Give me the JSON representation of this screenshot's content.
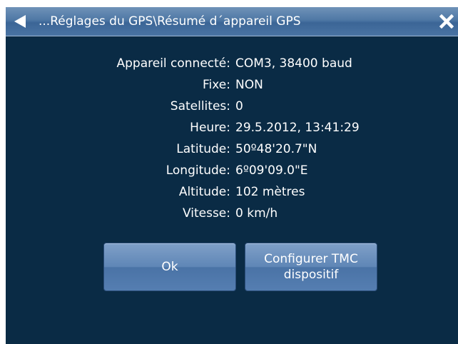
{
  "header": {
    "title": "...Réglages du GPS\\Résumé d´appareil GPS",
    "back_icon": "back-arrow-icon",
    "close_icon": "close-icon"
  },
  "summary": [
    {
      "label": "Appareil connecté:",
      "value": "COM3, 38400 baud"
    },
    {
      "label": "Fixe:",
      "value": "NON"
    },
    {
      "label": "Satellites:",
      "value": "0"
    },
    {
      "label": "Heure:",
      "value": "29.5.2012, 13:41:29"
    },
    {
      "label": "Latitude:",
      "value": "50º48'20.7\"N"
    },
    {
      "label": "Longitude:",
      "value": "6º09'09.0\"E"
    },
    {
      "label": "Altitude:",
      "value": "102 mètres"
    },
    {
      "label": "Vitesse:",
      "value": "0 km/h"
    }
  ],
  "buttons": {
    "ok_label": "Ok",
    "tmc_label_line1": "Configurer TMC",
    "tmc_label_line2": "dispositif"
  },
  "colors": {
    "background": "#0a2b45",
    "titlebar": "#4f78a5",
    "button": "#5f86b6",
    "text": "#ffffff"
  }
}
